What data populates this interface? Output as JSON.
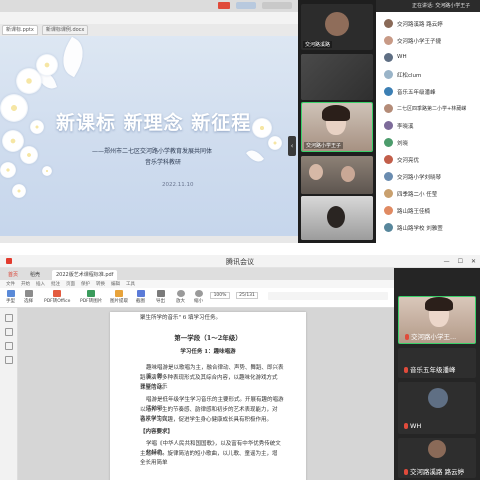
{
  "top": {
    "browser": {
      "tab1": "新课标.pptx",
      "tab2": "新课标课例.docx"
    },
    "slide": {
      "title": "新课标 新理念 新征程",
      "subtitle_line1": "——郑州市二七区交河路小学教育发展共同体",
      "subtitle_line2": "音乐学科教研",
      "date": "2022.11.10"
    },
    "video_tiles": [
      {
        "label": "交河路溪路"
      },
      {
        "label": ""
      },
      {
        "label": "交河路小学王子"
      },
      {
        "label": ""
      },
      {
        "label": ""
      }
    ],
    "participants_header": "正在讲话: 交河路小学王子",
    "participants": [
      {
        "name": "交河路溪路  路云婷",
        "color": "#8a6a58"
      },
      {
        "name": "交河路小学王子捷",
        "color": "#c89a86"
      },
      {
        "name": "WH",
        "color": "#5f6f84"
      },
      {
        "name": "红松clum",
        "color": "#9ab4c8"
      },
      {
        "name": "音乐五年级潘峰",
        "color": "#3c7fb4"
      },
      {
        "name": "二七区四季路第二小学+林葳嵘",
        "color": "#b48c78"
      },
      {
        "name": "李晓溪",
        "color": "#7d6b9a"
      },
      {
        "name": "刘晓",
        "color": "#4c9c6c"
      },
      {
        "name": "交河亮优",
        "color": "#c25e4a"
      },
      {
        "name": "交河路小学刘晓琴",
        "color": "#6a8cb0"
      },
      {
        "name": "四季路二小 任莹",
        "color": "#c9a06e"
      },
      {
        "name": "路山路王佳楠",
        "color": "#e08a62"
      },
      {
        "name": "路山路学校 刘雅萱",
        "color": "#58879c"
      }
    ]
  },
  "bottom": {
    "window_title": "腾讯会议",
    "doc_tabs": [
      "首页",
      "稻壳",
      "2022版艺术课程标准.pdf"
    ],
    "menu": [
      "文件",
      "开始",
      "插入",
      "批注",
      "页面",
      "保护",
      "转换",
      "编辑",
      "工具"
    ],
    "ribbon": [
      "手型",
      "选择",
      "PDF转Office",
      "PDF转图片",
      "图片提取",
      "截图",
      "导出",
      "放大",
      "缩小"
    ],
    "zoom": "100%",
    "page": "25/131",
    "doc_lines": [
      "聚生所学的音乐\" 6 填学习任务。",
      "第一学段（1～2年级）",
      "学习任务 1：趣味唱游",
      "趣味唱游是以歌唱为主，融合律动、声势、舞蹈、即兴表演、舞",
      "蹈表演等多种表现形式及其综合内容，以趣味化游戏方式开展的音乐",
      "课堂活动。",
      "唱游是低年级学生学习音乐的主要形式。开展有趣的唱游活动可",
      "以培养学生的节奏感、韵律感和初步的艺术表现能力，对激发学生在",
      "音乐学习兴趣，促进学生身心健康成长具有积极作用。",
      "【内容要求】",
      "学唱《中华人民共和国国歌》，以及富有中华优秀传统文化特色、",
      "主题鲜明、旋律简洁的短小歌曲，以儿歌、童谣为主，增全长用简单"
    ],
    "video_tiles": [
      {
        "label": "交河路小学王..."
      },
      {
        "label": "音乐五年级潘峰"
      },
      {
        "label": "WH"
      },
      {
        "label": "交河路溪路 路云婷"
      }
    ]
  },
  "colors": {
    "accent_blue": "#1e7ae6",
    "mic_red": "#e04b3b",
    "slide_bg": "#cfdcee"
  }
}
